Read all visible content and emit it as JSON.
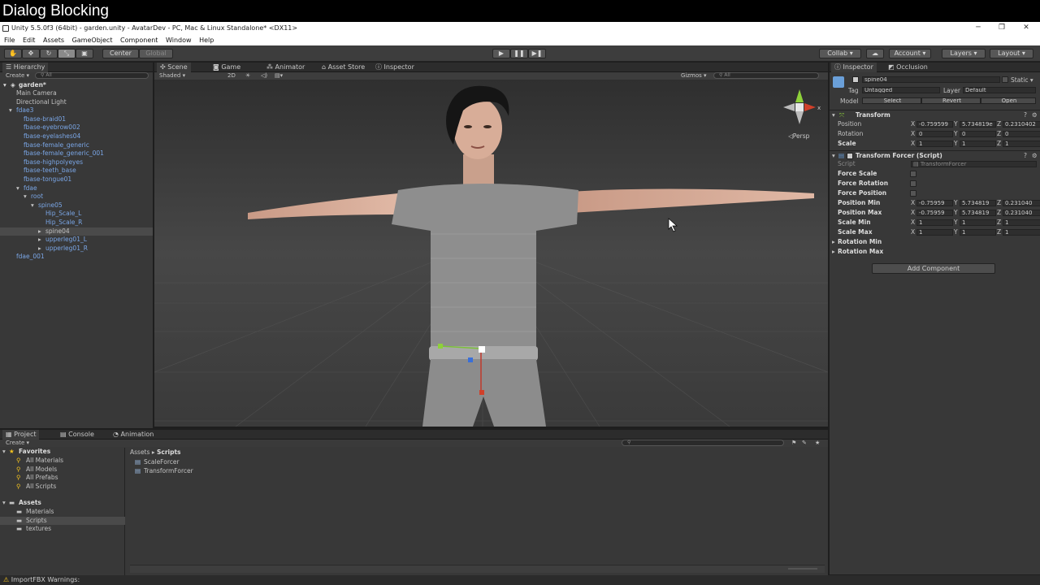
{
  "banner": {
    "text": "Dialog Blocking"
  },
  "window": {
    "title": "Unity 5.5.0f3 (64bit) - garden.unity - AvatarDev - PC, Mac & Linux Standalone* <DX11>",
    "minimize": "─",
    "restore": "❐",
    "close": "✕"
  },
  "menu": [
    "File",
    "Edit",
    "Assets",
    "GameObject",
    "Component",
    "Window",
    "Help"
  ],
  "toolbar": {
    "pivot": "Center",
    "space": "Global",
    "play": "▶",
    "pause": "❚❚",
    "step": "▶❚",
    "collab": "Collab ▾",
    "cloud": "☁",
    "account": "Account ▾",
    "layers": "Layers ▾",
    "layout": "Layout ▾"
  },
  "hierarchy": {
    "tab": "Hierarchy",
    "create": "Create ▾",
    "search": "All",
    "scene": "garden*",
    "items": [
      {
        "label": "Main Camera",
        "indent": 0,
        "blue": false,
        "arrow": ""
      },
      {
        "label": "Directional Light",
        "indent": 0,
        "blue": false,
        "arrow": ""
      },
      {
        "label": "fdae3",
        "indent": 0,
        "blue": true,
        "arrow": "▾"
      },
      {
        "label": "fbase-braid01",
        "indent": 1,
        "blue": true,
        "arrow": ""
      },
      {
        "label": "fbase-eyebrow002",
        "indent": 1,
        "blue": true,
        "arrow": ""
      },
      {
        "label": "fbase-eyelashes04",
        "indent": 1,
        "blue": true,
        "arrow": ""
      },
      {
        "label": "fbase-female_generic",
        "indent": 1,
        "blue": true,
        "arrow": ""
      },
      {
        "label": "fbase-female_generic_001",
        "indent": 1,
        "blue": true,
        "arrow": ""
      },
      {
        "label": "fbase-highpolyeyes",
        "indent": 1,
        "blue": true,
        "arrow": ""
      },
      {
        "label": "fbase-teeth_base",
        "indent": 1,
        "blue": true,
        "arrow": ""
      },
      {
        "label": "fbase-tongue01",
        "indent": 1,
        "blue": true,
        "arrow": ""
      },
      {
        "label": "fdae",
        "indent": 1,
        "blue": true,
        "arrow": "▾"
      },
      {
        "label": "root",
        "indent": 2,
        "blue": true,
        "arrow": "▾"
      },
      {
        "label": "spine05",
        "indent": 3,
        "blue": true,
        "arrow": "▾"
      },
      {
        "label": "Hip_Scale_L",
        "indent": 4,
        "blue": true,
        "arrow": ""
      },
      {
        "label": "Hip_Scale_R",
        "indent": 4,
        "blue": true,
        "arrow": ""
      },
      {
        "label": "spine04",
        "indent": 4,
        "blue": false,
        "arrow": "▸",
        "selected": true
      },
      {
        "label": "upperleg01_L",
        "indent": 4,
        "blue": true,
        "arrow": "▸"
      },
      {
        "label": "upperleg01_R",
        "indent": 4,
        "blue": true,
        "arrow": "▸"
      },
      {
        "label": "fdae_001",
        "indent": 0,
        "blue": true,
        "arrow": ""
      }
    ]
  },
  "sceneView": {
    "tabs": [
      "Scene",
      "Game",
      "Animator",
      "Asset Store",
      "Inspector"
    ],
    "shading": "Shaded ▾",
    "mode2d": "2D",
    "gizmos": "Gizmos ▾",
    "search": "All",
    "persp": "Persp"
  },
  "inspector": {
    "tabs": [
      "Inspector",
      "Occlusion"
    ],
    "objectName": "spine04",
    "static": "Static ▾",
    "tagLabel": "Tag",
    "tag": "Untagged",
    "layerLabel": "Layer",
    "layer": "Default",
    "modelLabel": "Model",
    "select": "Select",
    "revert": "Revert",
    "open": "Open",
    "transform": {
      "title": "Transform",
      "rows": [
        {
          "label": "Position",
          "x": "-0.759599",
          "y": "5.734819e",
          "z": "0.2310402"
        },
        {
          "label": "Rotation",
          "x": "0",
          "y": "0",
          "z": "0"
        },
        {
          "label": "Scale",
          "x": "1",
          "y": "1",
          "z": "1"
        }
      ]
    },
    "forcer": {
      "title": "Transform Forcer (Script)",
      "scriptLabel": "Script",
      "script": "TransformForcer",
      "checks": [
        "Force Scale",
        "Force Rotation",
        "Force Position"
      ],
      "rows": [
        {
          "label": "Position Min",
          "x": "-0.75959",
          "y": "5.734819",
          "z": "0.231040"
        },
        {
          "label": "Position Max",
          "x": "-0.75959",
          "y": "5.734819",
          "z": "0.231040"
        },
        {
          "label": "Scale Min",
          "x": "1",
          "y": "1",
          "z": "1"
        },
        {
          "label": "Scale Max",
          "x": "1",
          "y": "1",
          "z": "1"
        }
      ],
      "foldouts": [
        "Rotation Min",
        "Rotation Max"
      ]
    },
    "addComponent": "Add Component"
  },
  "project": {
    "tabs": [
      "Project",
      "Console",
      "Animation"
    ],
    "create": "Create ▾",
    "favoritesTitle": "Favorites",
    "favorites": [
      "All Materials",
      "All Models",
      "All Prefabs",
      "All Scripts"
    ],
    "assetsTitle": "Assets",
    "folders": [
      "Materials",
      "Scripts",
      "textures"
    ],
    "breadcrumb": [
      "Assets",
      "Scripts"
    ],
    "files": [
      "ScaleForcer",
      "TransformForcer"
    ]
  },
  "status": {
    "text": "ImportFBX Warnings:"
  }
}
